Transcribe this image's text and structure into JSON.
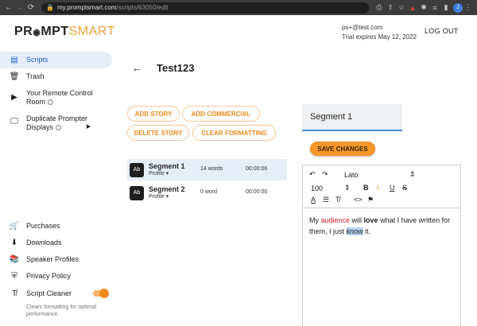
{
  "browser": {
    "back_icon": "←",
    "forward_icon": "→",
    "reload_icon": "⟳",
    "url_host": "my.promptsmart.com",
    "url_path": "/scripts/63050/edit",
    "profile_initial": "J"
  },
  "header": {
    "logo_main": "PROMPT",
    "logo_accent": "SMART",
    "logo_prefix": "PR",
    "logo_mic": "◉",
    "account_email": "ps+@test.com",
    "trial_text": "Trial expires May 12, 2022",
    "logout_label": "LOG OUT"
  },
  "sidebar": {
    "scripts": "Scripts",
    "trash": "Trash",
    "remote_line1": "Your Remote Control",
    "remote_line2": "Room",
    "duplicate_line1": "Duplicate Prompter",
    "duplicate_line2": "Displays",
    "purchases": "Purchases",
    "downloads": "Downloads",
    "speaker_profiles": "Speaker Profiles",
    "privacy_policy": "Privacy Policy",
    "script_cleaner": "Script Cleaner",
    "cleaner_note_1": "Clears formatting for optimal",
    "cleaner_note_2": "performance.",
    "cleaner_enabled": true
  },
  "main": {
    "back_icon": "←",
    "script_title": "Test123",
    "buttons": {
      "add_story": "ADD STORY",
      "add_commercial": "ADD COMMERCIAL",
      "delete_story": "DELETE STORY",
      "clear_formatting": "CLEAR FORMATTING"
    },
    "segments": [
      {
        "badge": "Ab",
        "name": "Segment 1",
        "profile": "Profile ▾",
        "words": "14 words",
        "time": "00:00:06",
        "selected": true
      },
      {
        "badge": "Ab",
        "name": "Segment 2",
        "profile": "Profile ▾",
        "words": "0 word",
        "time": "00:00:00",
        "selected": false
      }
    ]
  },
  "editor": {
    "segment_title": "Segment 1",
    "save_label": "SAVE CHANGES",
    "font_name": "Lato",
    "font_size": "100",
    "text": {
      "t1": "My ",
      "t2": "audience",
      "t3": " will ",
      "t4": "love",
      "t5": " what I have written for them, I just ",
      "t6": "know",
      "t7": " it."
    }
  },
  "colors": {
    "accent": "#f08a1c",
    "selected_bg": "#e5eef9",
    "active_text": "#1e5fbf"
  }
}
